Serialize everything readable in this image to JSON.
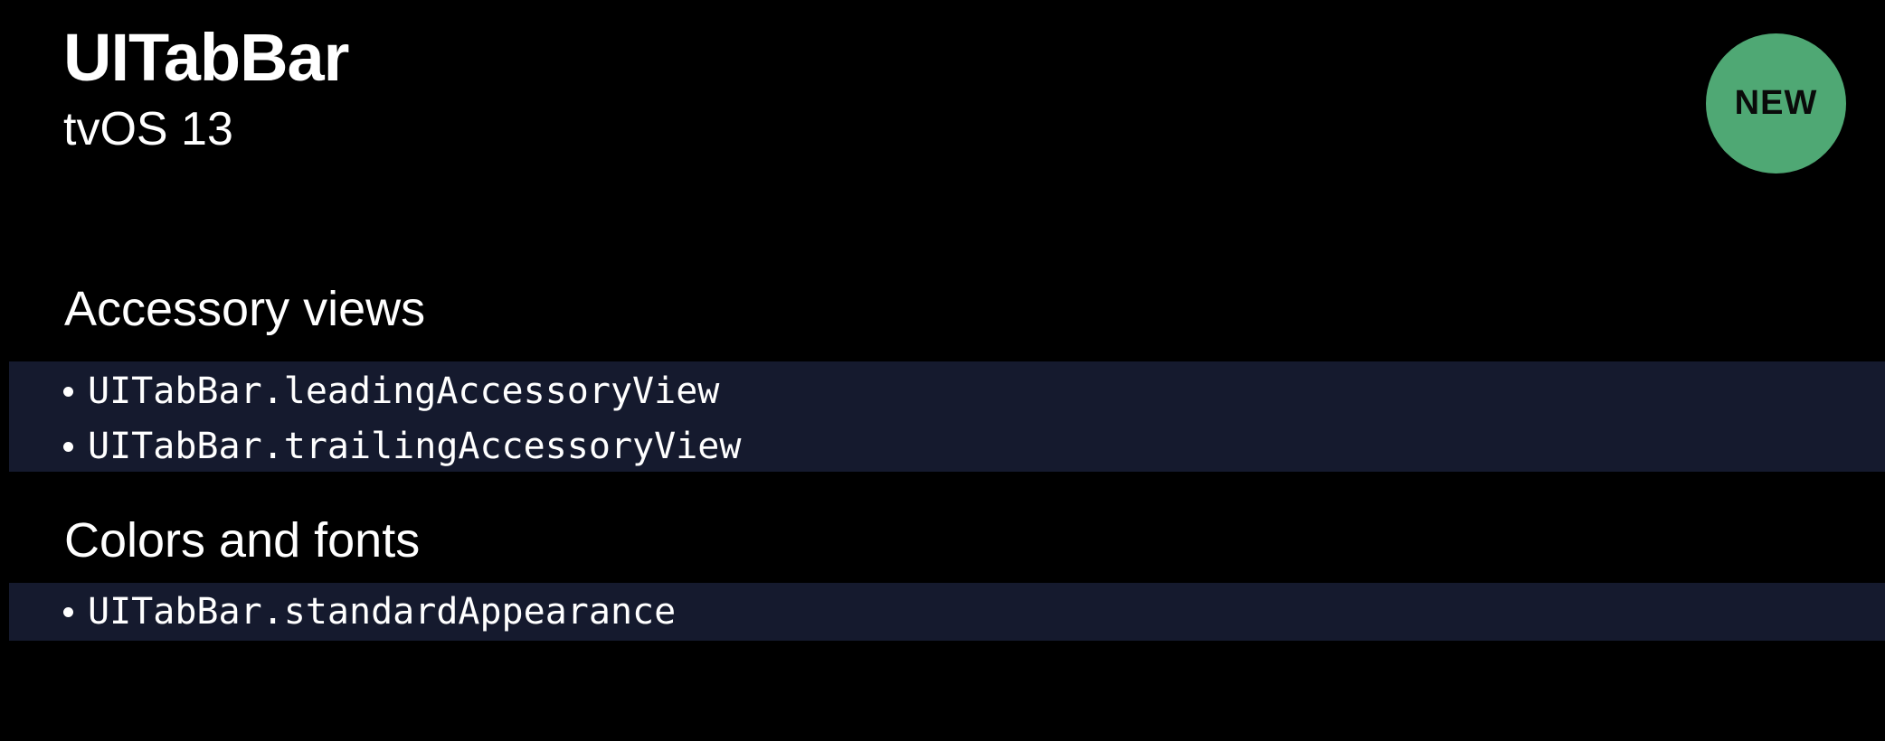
{
  "slide": {
    "title": "UITabBar",
    "subtitle": "tvOS 13",
    "badge": "NEW"
  },
  "sections": [
    {
      "heading": "Accessory views",
      "items": [
        "UITabBar.leadingAccessoryView",
        "UITabBar.trailingAccessoryView"
      ]
    },
    {
      "heading": "Colors and fonts",
      "items": [
        "UITabBar.standardAppearance"
      ]
    }
  ],
  "colors": {
    "background": "#000000",
    "badge": "#4fa874",
    "code_highlight": "#151a2e",
    "text": "#ffffff"
  }
}
